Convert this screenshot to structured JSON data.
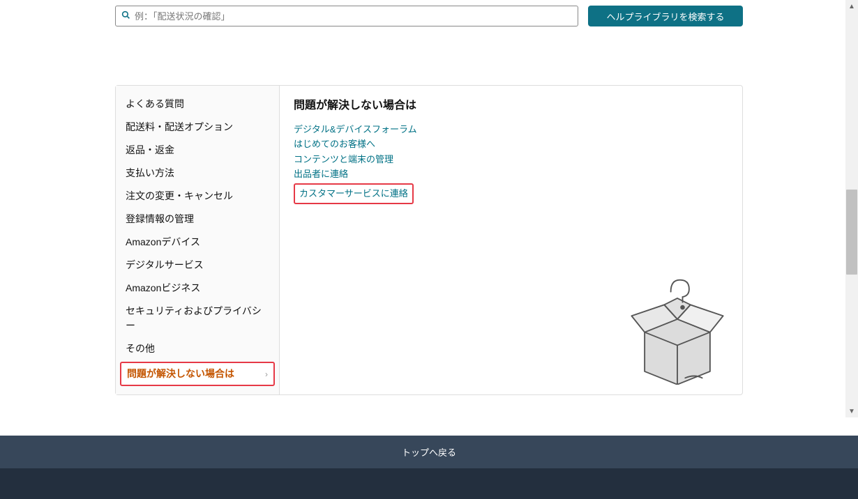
{
  "search": {
    "placeholder": "例：「配送状況の確認」",
    "button_label": "ヘルプライブラリを検索する",
    "icon_name": "search-icon"
  },
  "sidebar": {
    "items": [
      {
        "label": "よくある質問"
      },
      {
        "label": "配送料・配送オプション"
      },
      {
        "label": "返品・返金"
      },
      {
        "label": "支払い方法"
      },
      {
        "label": "注文の変更・キャンセル"
      },
      {
        "label": "登録情報の管理"
      },
      {
        "label": "Amazonデバイス"
      },
      {
        "label": "デジタルサービス"
      },
      {
        "label": "Amazonビジネス"
      },
      {
        "label": "セキュリティおよびプライバシー"
      },
      {
        "label": "その他"
      },
      {
        "label": "問題が解決しない場合は",
        "active": true
      }
    ]
  },
  "main": {
    "title": "問題が解決しない場合は",
    "links": [
      {
        "label": "デジタル&デバイスフォーラム"
      },
      {
        "label": "はじめてのお客様へ"
      },
      {
        "label": "コンテンツと端末の管理"
      },
      {
        "label": "出品者に連絡"
      },
      {
        "label": "カスタマーサービスに連絡",
        "highlighted": true
      }
    ],
    "illustration": "open-box-question-icon"
  },
  "footer": {
    "back_to_top": "トップへ戻る"
  },
  "colors": {
    "link": "#007185",
    "active": "#c45500",
    "highlight_border": "#e63946",
    "button_bg": "#0e7185",
    "footer_back": "#37475a",
    "footer_dark": "#232f3e"
  }
}
